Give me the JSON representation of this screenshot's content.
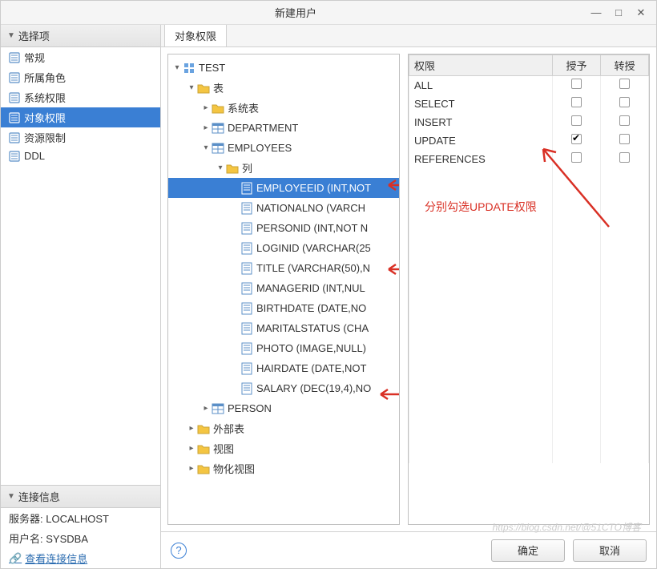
{
  "title": "新建用户",
  "left": {
    "options_header": "选择项",
    "nav": [
      {
        "label": "常规"
      },
      {
        "label": "所属角色"
      },
      {
        "label": "系统权限"
      },
      {
        "label": "对象权限"
      },
      {
        "label": "资源限制"
      },
      {
        "label": "DDL"
      }
    ],
    "selected_nav": 3,
    "conn_header": "连接信息",
    "server_label": "服务器:",
    "server_value": "LOCALHOST",
    "user_label": "用户名:",
    "user_value": "SYSDBA",
    "link_label": "查看连接信息"
  },
  "tab_label": "对象权限",
  "tree": {
    "root": "TEST",
    "tables_label": "表",
    "sys_tables": "系统表",
    "department": "DEPARTMENT",
    "employees": "EMPLOYEES",
    "columns_label": "列",
    "columns": [
      "EMPLOYEEID (INT,NOT",
      "NATIONALNO (VARCH",
      "PERSONID (INT,NOT N",
      "LOGINID (VARCHAR(25",
      "TITLE (VARCHAR(50),N",
      "MANAGERID (INT,NUL",
      "BIRTHDATE (DATE,NO",
      "MARITALSTATUS (CHA",
      "PHOTO (IMAGE,NULL)",
      "HAIRDATE (DATE,NOT",
      "SALARY (DEC(19,4),NO"
    ],
    "selected_column": 0,
    "person": "PERSON",
    "ext_tables": "外部表",
    "views": "视图",
    "mat_views": "物化视图"
  },
  "perm": {
    "col_perm": "权限",
    "col_grant": "授予",
    "col_transfer": "转授",
    "rows": [
      {
        "name": "ALL",
        "grant": false,
        "transfer": false
      },
      {
        "name": "SELECT",
        "grant": false,
        "transfer": false
      },
      {
        "name": "INSERT",
        "grant": false,
        "transfer": false
      },
      {
        "name": "UPDATE",
        "grant": true,
        "transfer": false
      },
      {
        "name": "REFERENCES",
        "grant": false,
        "transfer": false
      }
    ]
  },
  "annotation_text": "分别勾选UPDATE权限",
  "ok": "确定",
  "cancel": "取消",
  "watermark": "https://blog.csdn.net/@51CTO博客"
}
